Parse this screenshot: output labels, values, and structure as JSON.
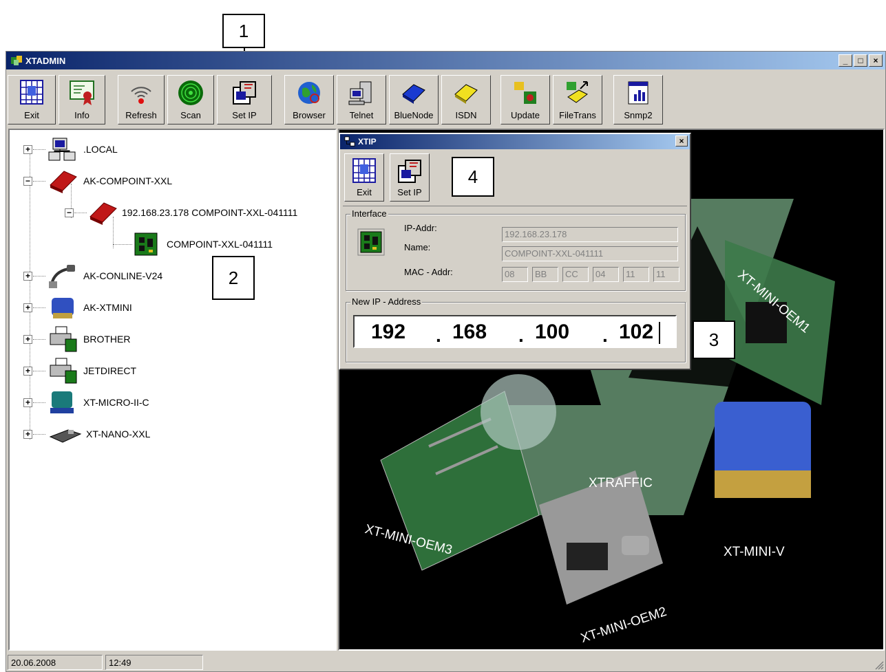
{
  "callouts": [
    "1",
    "2",
    "3",
    "4"
  ],
  "window": {
    "title": "XTADMIN",
    "controls": [
      "_",
      "□",
      "×"
    ]
  },
  "toolbar": {
    "exit": "Exit",
    "info": "Info",
    "refresh": "Refresh",
    "scan": "Scan",
    "set_ip": "Set IP",
    "browser": "Browser",
    "telnet": "Telnet",
    "bluenode": "BlueNode",
    "isdn": "ISDN",
    "update": "Update",
    "filetrans": "FileTrans",
    "snmp2": "Snmp2"
  },
  "tree": {
    "local": ".LOCAL",
    "compoint": "AK-COMPOINT-XXL",
    "compoint_ip": "192.168.23.178  COMPOINT-XXL-041111",
    "compoint_iface": "COMPOINT-XXL-041111",
    "conline": "AK-CONLINE-V24",
    "xtmini": "AK-XTMINI",
    "brother": "BROTHER",
    "jetdirect": "JETDIRECT",
    "xtmicro": "XT-MICRO-II-C",
    "xtnano": "XT-NANO-XXL",
    "expander_plus": "+",
    "expander_minus": "−"
  },
  "picture": {
    "oem1": "XT-MINI-OEM1",
    "oem2": "XT-MINI-OEM2",
    "oem3": "XT-MINI-OEM3",
    "miniv": "XT-MINI-V",
    "xtraffic": "XTRAFFIC"
  },
  "dialog": {
    "title": "XTIP",
    "close": "×",
    "exit": "Exit",
    "set_ip": "Set IP",
    "interface": {
      "group_title": "Interface",
      "ip_label": "IP-Addr:",
      "ip_value": "192.168.23.178",
      "name_label": "Name:",
      "name_value": "COMPOINT-XXL-041111",
      "mac_label": "MAC - Addr:",
      "mac": [
        "08",
        "BB",
        "CC",
        "04",
        "11",
        "11"
      ]
    },
    "new_ip": {
      "group_title": "New IP - Address",
      "octets": [
        "192",
        "168",
        "100",
        "102"
      ],
      "dot": "."
    }
  },
  "status": {
    "date": "20.06.2008",
    "time": "12:49"
  },
  "colors": {
    "titlebar_start": "#0a246a",
    "titlebar_end": "#a6caf0",
    "window_bg": "#d4d0c8",
    "picture_bg": "#000000"
  }
}
